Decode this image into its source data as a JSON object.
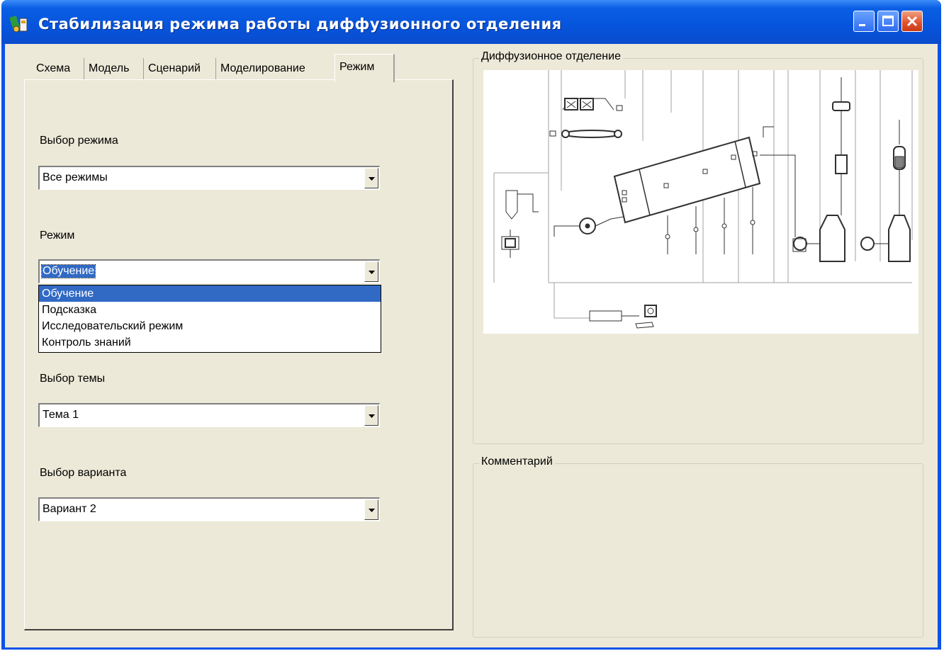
{
  "window": {
    "title": "Стабилизация режима работы диффузионного отделения",
    "icon": "app-icon"
  },
  "tabs": [
    {
      "label": "Схема",
      "active": false
    },
    {
      "label": "Модель",
      "active": false
    },
    {
      "label": "Сценарий",
      "active": false
    },
    {
      "label": "Моделирование",
      "active": false
    },
    {
      "label": "Режим",
      "active": true
    }
  ],
  "mode_panel": {
    "mode_set_label": "Выбор режима",
    "mode_set_value": "Все режимы",
    "mode_label": "Режим",
    "mode_value": "Обучение",
    "mode_options": [
      "Обучение",
      "Подсказка",
      "Исследовательский режим",
      "Контроль знаний"
    ],
    "topic_label": "Выбор темы",
    "topic_value": "Тема 1",
    "variant_label": "Выбор варианта",
    "variant_value": "Вариант 2"
  },
  "diagram_group": {
    "title": "Диффузионное отделение"
  },
  "comment_group": {
    "title": "Комментарий"
  }
}
